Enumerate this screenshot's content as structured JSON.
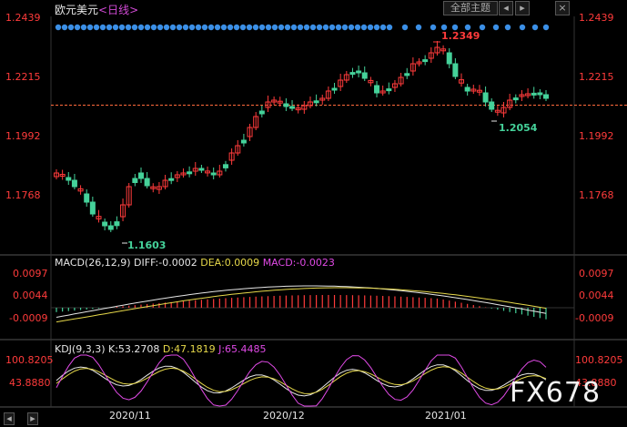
{
  "header": {
    "instrument": "欧元美元",
    "timeframe": "<日线>",
    "buttons": {
      "grid": "全部主题",
      "left": "◂",
      "right": "▸",
      "close": "×"
    }
  },
  "price_axis": {
    "ticks": [
      "1.2439",
      "1.2215",
      "1.1992",
      "1.1768"
    ]
  },
  "annotations": {
    "high": "1.2349",
    "low": "1.1603",
    "recent_low": "1.2054"
  },
  "macd": {
    "title": "MACD(26,12,9)",
    "diff": "DIFF:-0.0002",
    "dea": "DEA:0.0009",
    "macd": "MACD:-0.0023",
    "ticks": [
      "0.0097",
      "0.0044",
      "-0.0009"
    ]
  },
  "kdj": {
    "title": "KDJ(9,3,3)",
    "k": "K:53.2708",
    "d": "D:47.1819",
    "j": "J:65.4485",
    "ticks": [
      "100.8205",
      "43.8880"
    ]
  },
  "time_axis": [
    "2020/11",
    "2020/12",
    "2021/01"
  ],
  "watermark": "FX678",
  "colors": {
    "up": "#ff3b3b",
    "down": "#45d29a",
    "dots": "#3b8fe6",
    "dea": "#e6d84a",
    "j": "#e04ae6"
  }
}
